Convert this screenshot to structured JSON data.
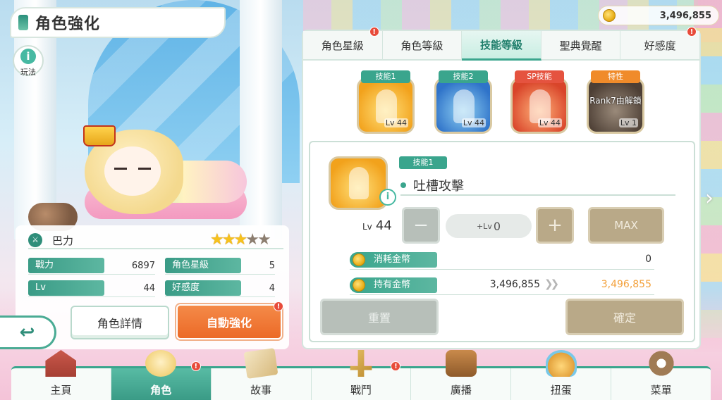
{
  "header": {
    "title": "角色強化",
    "gold": "3,496,855",
    "howto_label": "玩法"
  },
  "character": {
    "name": "巴力",
    "stars_total": 5,
    "stars_filled": 3
  },
  "stats": {
    "power": {
      "label": "戰力",
      "value": "6897"
    },
    "star_level": {
      "label": "角色星級",
      "value": "5"
    },
    "lv": {
      "label": "Lv",
      "value": "44"
    },
    "affection": {
      "label": "好感度",
      "value": "4"
    }
  },
  "left_buttons": {
    "detail": "角色詳情",
    "auto_enhance": "自動強化",
    "badge": "!"
  },
  "tabs": [
    {
      "label": "角色星級",
      "badge": "!"
    },
    {
      "label": "角色等級",
      "badge": ""
    },
    {
      "label": "技能等級",
      "badge": "",
      "active": true
    },
    {
      "label": "聖典覺醒",
      "badge": ""
    },
    {
      "label": "好感度",
      "badge": "!"
    }
  ],
  "skills": [
    {
      "tag": "技能1",
      "lv": "Lv 44",
      "tag_color": "#3aa58d"
    },
    {
      "tag": "技能2",
      "lv": "Lv 44",
      "tag_color": "#3aa58d"
    },
    {
      "tag": "SP技能",
      "lv": "Lv 44",
      "tag_color": "#e5533f"
    },
    {
      "tag": "特性",
      "lv": "Lv 1",
      "tag_color": "#f08b2a",
      "locked_text": "Rank7由解鎖"
    }
  ],
  "detail": {
    "skill_tag": "技能1",
    "skill_name": "吐槽攻擊",
    "info_icon": "i",
    "current_lv_prefix": "Lv",
    "current_lv": "44",
    "minus": "−",
    "plus": "+",
    "add_lv_prefix": "+Lv",
    "add_lv_value": "0",
    "max_label": "MAX",
    "cost_label": "消耗金幣",
    "cost_value": "0",
    "owned_label": "持有金幣",
    "owned_from": "3,496,855",
    "owned_to": "3,496,855",
    "reset_label": "重置",
    "confirm_label": "確定"
  },
  "nav": [
    {
      "label": "主頁",
      "icon": "castle-icon",
      "badge": ""
    },
    {
      "label": "角色",
      "icon": "character-icon",
      "badge": "!",
      "active": true
    },
    {
      "label": "故事",
      "icon": "book-icon",
      "badge": ""
    },
    {
      "label": "戰鬥",
      "icon": "sword-icon",
      "badge": "!"
    },
    {
      "label": "廣播",
      "icon": "radio-icon",
      "badge": ""
    },
    {
      "label": "扭蛋",
      "icon": "gacha-icon",
      "badge": ""
    },
    {
      "label": "菜單",
      "icon": "gear-icon",
      "badge": ""
    }
  ],
  "colors": {
    "accent": "#3aa58d",
    "orange": "#ec6a27",
    "gold_text": "#f3a13c"
  }
}
